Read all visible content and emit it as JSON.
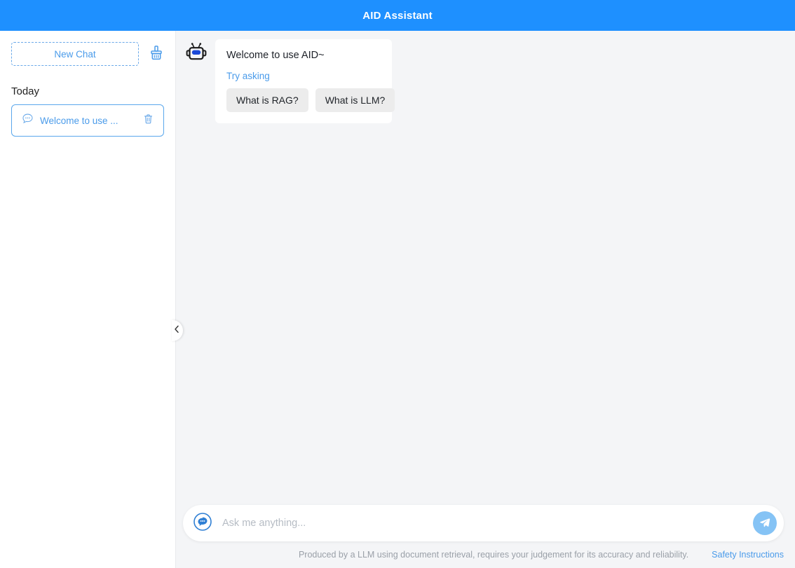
{
  "header": {
    "title": "AID Assistant",
    "background": "#1e90ff",
    "text_color": "#ffffff"
  },
  "sidebar": {
    "new_chat_label": "New Chat",
    "clear_icon": "broom-icon",
    "section_title": "Today",
    "chats": [
      {
        "icon": "chat-bubble-icon",
        "label": "Welcome to use ...",
        "delete_icon": "trash-icon",
        "selected": true
      }
    ],
    "accent_color": "#4a9bea"
  },
  "collapse_toggle": {
    "icon": "chevron-left-icon"
  },
  "conversation": {
    "messages": [
      {
        "avatar_icon": "robot-icon",
        "text": "Welcome to use AID~",
        "try_asking_label": "Try asking",
        "suggestions": [
          "What is RAG?",
          "What is LLM?"
        ]
      }
    ]
  },
  "composer": {
    "left_icon": "chat-dots-icon",
    "placeholder": "Ask me anything...",
    "value": "",
    "send_icon": "send-plane-icon",
    "send_color": "#85c3f5"
  },
  "footer": {
    "note": "Produced by a LLM using document retrieval, requires your judgement for its accuracy and reliability.",
    "link_label": "Safety Instructions",
    "link_color": "#4a9bea"
  }
}
